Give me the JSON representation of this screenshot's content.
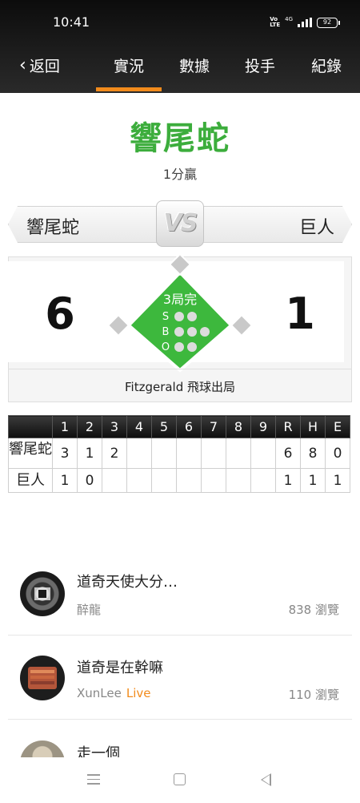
{
  "status": {
    "time": "10:41",
    "network": "4G",
    "battery": "92",
    "volte": "Vo LTE"
  },
  "nav": {
    "back_label": "返回",
    "tabs": [
      "實況",
      "數據",
      "投手",
      "紀錄"
    ],
    "active_tab": "實況"
  },
  "result": {
    "winner": "響尾蛇",
    "margin": "1分贏"
  },
  "matchup": {
    "away_team": "響尾蛇",
    "home_team": "巨人",
    "vs_label": "VS",
    "away_score": "6",
    "home_score": "1"
  },
  "game_state": {
    "inning_text": "3局完",
    "count_labels": [
      "S",
      "B",
      "O"
    ],
    "strikes": 0,
    "balls": 0,
    "outs": 0,
    "last_play": "Fitzgerald 飛球出局"
  },
  "linescore": {
    "headers": [
      "",
      "1",
      "2",
      "3",
      "4",
      "5",
      "6",
      "7",
      "8",
      "9",
      "R",
      "H",
      "E"
    ],
    "rows": [
      {
        "team": "響尾蛇",
        "cells": [
          "3",
          "1",
          "2",
          "",
          "",
          "",
          "",
          "",
          "",
          "6",
          "8",
          "0"
        ]
      },
      {
        "team": "巨人",
        "cells": [
          "1",
          "0",
          "",
          "",
          "",
          "",
          "",
          "",
          "",
          "1",
          "1",
          "1"
        ]
      }
    ]
  },
  "feed": [
    {
      "title": "道奇天使大分…",
      "author": "醉龍",
      "live": "",
      "views": "838 瀏覽"
    },
    {
      "title": "道奇是在幹嘛",
      "author": "XunLee",
      "live": "Live",
      "views": "110 瀏覽"
    },
    {
      "title": "走一個",
      "author": "",
      "live": "",
      "views": ""
    }
  ],
  "colors": {
    "accent": "#f28b1c",
    "winner": "#3cad3c",
    "field": "#3db83d"
  }
}
